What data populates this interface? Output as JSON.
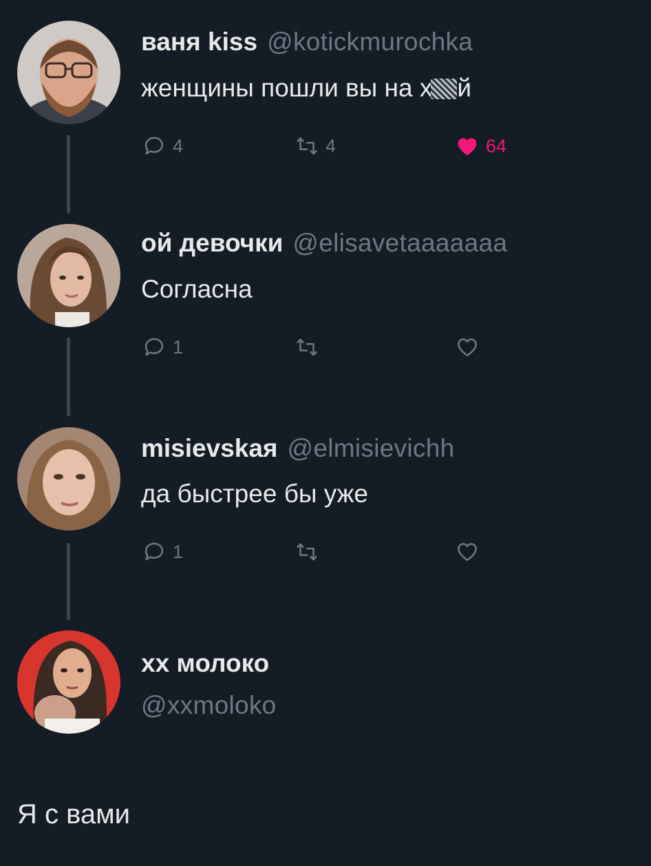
{
  "colors": {
    "background": "#141c25",
    "text_primary": "#e7e9ea",
    "text_secondary": "#6e7882",
    "like_active": "#f0197a",
    "connector": "#3b4550"
  },
  "tweets": [
    {
      "name": "ваня kiss",
      "handle": "@kotickmurochka",
      "text": "женщины пошли вы на х",
      "text_tail": "й",
      "reply_count": "4",
      "retweet_count": "4",
      "like_count": "64",
      "liked": true,
      "avatar_icon": "avatar-bearded-man-glasses"
    },
    {
      "name": "ой девочки",
      "handle": "@elisavetaaaaaaa",
      "text": "Согласна",
      "reply_count": "1",
      "retweet_count": "",
      "like_count": "",
      "liked": false,
      "avatar_icon": "avatar-woman-long-hair"
    },
    {
      "name": "misievskaя",
      "handle": "@elmisievichh",
      "text": "да быстрее бы уже",
      "reply_count": "1",
      "retweet_count": "",
      "like_count": "",
      "liked": false,
      "avatar_icon": "avatar-woman-short-hair"
    }
  ],
  "composer": {
    "name": "хх молоко",
    "handle": "@xxmoloko",
    "avatar_icon": "avatar-woman-red-background",
    "reply_text": "Я с вами"
  },
  "icons": {
    "reply": "reply-bubble-icon",
    "retweet": "retweet-icon",
    "like": "heart-icon"
  }
}
